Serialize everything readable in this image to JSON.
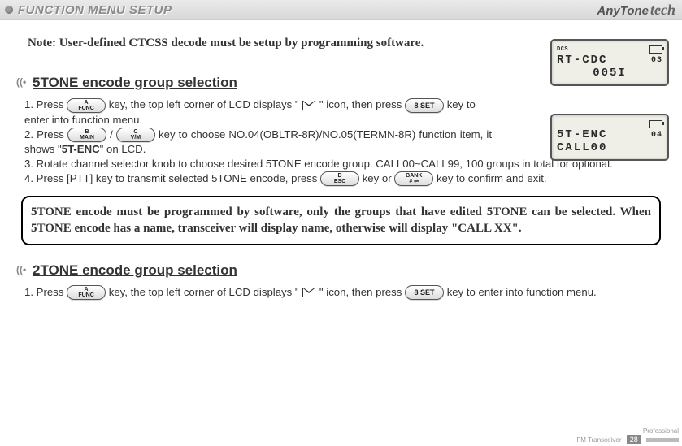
{
  "header": {
    "title": "FUNCTION MENU SETUP",
    "brand": {
      "name": "AnyTone",
      "suffix": "tech"
    }
  },
  "note": "Note: User-defined CTCSS decode must be setup by programming software.",
  "lcd1": {
    "dcs": "DCS",
    "line1": "RT-CDC",
    "line2": "005I",
    "num": "03"
  },
  "section1": {
    "title": "5TONE encode group selection",
    "step1a": "1. Press ",
    "step1b": " key, the top left corner of LCD displays \"",
    "step1c": "\" icon, then press ",
    "step1d": " key to enter into function menu.",
    "step2a": "2. Press ",
    "step2b": " / ",
    "step2c": " key to choose NO.04(OBLTR-8R)/NO.05(TERMN-8R) function item, it shows \"",
    "step2_bold": "5T-ENC",
    "step2d": "\" on LCD.",
    "step3": "3. Rotate channel selector knob to choose desired 5TONE encode group. CALL00~CALL99, 100 groups in total for optional.",
    "step4a": "4. Press [PTT] key to transmit selected 5TONE encode, press ",
    "step4b": " key or ",
    "step4c": " key to confirm and exit."
  },
  "lcd2": {
    "line1": "5T-ENC",
    "line2": "CALL00",
    "num": "04"
  },
  "boxnote": "5TONE encode must be programmed by software, only the groups that have edited 5TONE can be selected.  When 5TONE encode has a name, transceiver will display name, otherwise will display \"CALL XX\".",
  "section2": {
    "title": "2TONE encode group selection",
    "step1a": "1. Press ",
    "step1b": " key, the top left corner of LCD displays \"",
    "step1c": "\" icon, then press ",
    "step1d": " key to enter into function menu."
  },
  "buttons": {
    "func": {
      "sup": "A",
      "sub": "FUNC"
    },
    "set8": {
      "label": "8 SET"
    },
    "main": {
      "sup": "B",
      "sub": "MAIN"
    },
    "vm": {
      "sup": "C",
      "sub": "V/M"
    },
    "esc": {
      "sup": "D",
      "sub": "ESC"
    },
    "bank": {
      "sup": "BANK",
      "sub": "# ⇌"
    }
  },
  "footer": {
    "line1": "Professional",
    "line2": "FM Transceiver",
    "page": "28"
  }
}
